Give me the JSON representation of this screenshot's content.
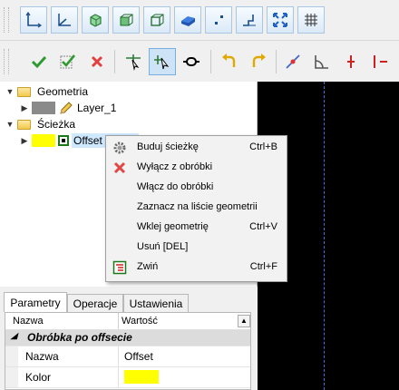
{
  "toolbar_top": {
    "icons": [
      "axis-xy-icon",
      "axis-xy-origin-icon",
      "view-iso-icon",
      "view-box-icon",
      "view-wire-box-icon",
      "view-solid-icon",
      "snap-points-icon",
      "stairs-profile-icon",
      "fit-view-icon",
      "grid-icon"
    ]
  },
  "toolbar_main": {
    "icons": [
      "accept-icon",
      "accept-all-icon",
      "reject-icon",
      "add-point-icon",
      "select-move-icon",
      "link-icon",
      "undo-icon",
      "redo-icon",
      "align-icon",
      "angle-icon",
      "marker-icon"
    ]
  },
  "tree": {
    "geometria": "Geometria",
    "layer1": "Layer_1",
    "sciezka": "Ścieżka",
    "offset": "Offset"
  },
  "menu": {
    "items": [
      {
        "label": "Buduj ścieżkę",
        "shortcut": "Ctrl+B",
        "icon": "gear-icon"
      },
      {
        "label": "Wyłącz z obróbki",
        "shortcut": "",
        "icon": "red-x-icon"
      },
      {
        "label": "Włącz do obróbki",
        "shortcut": "",
        "icon": ""
      },
      {
        "label": "Zaznacz na liście geometrii",
        "shortcut": "",
        "icon": ""
      },
      {
        "label": "Wklej geometrię",
        "shortcut": "Ctrl+V",
        "icon": ""
      },
      {
        "label": "Usuń [DEL]",
        "shortcut": "",
        "icon": ""
      },
      {
        "label": "Zwiń",
        "shortcut": "Ctrl+F",
        "icon": "collapse-list-icon"
      }
    ]
  },
  "tabs": {
    "parametry": "Parametry",
    "operacje": "Operacje",
    "ustawienia": "Ustawienia"
  },
  "props": {
    "col_name": "Nazwa",
    "col_value": "Wartość",
    "section": "Obróbka po offsecie",
    "row_nazwa_label": "Nazwa",
    "row_nazwa_value": "Offset",
    "row_kolor_label": "Kolor",
    "kolor_value": "#ffff00"
  },
  "colors": {
    "accent_blue": "#1e6fd1",
    "selection": "#cde8ff",
    "canvas": "#000000"
  }
}
